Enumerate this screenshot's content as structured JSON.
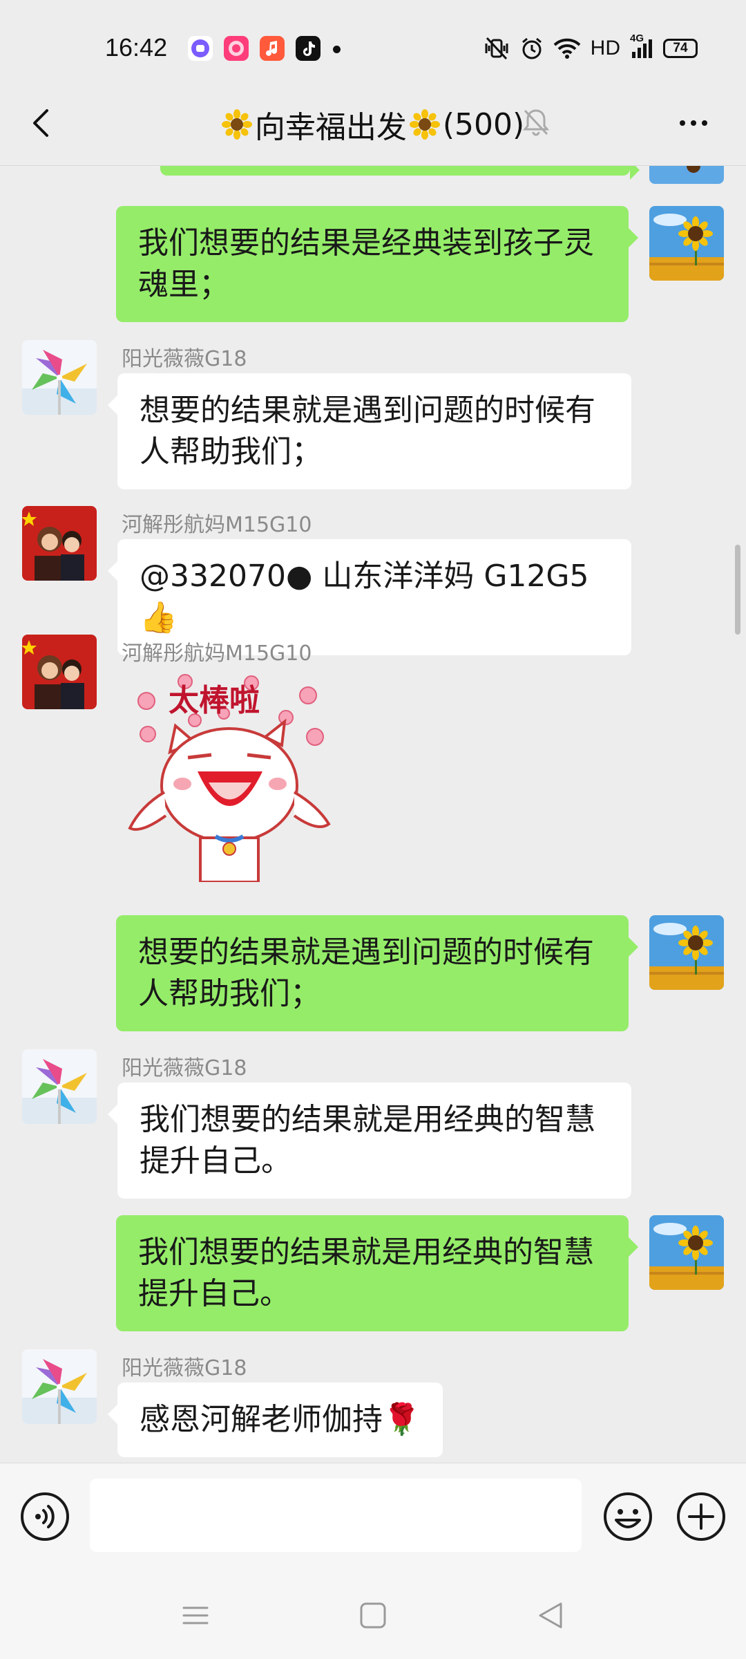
{
  "status_bar": {
    "time": "16:42",
    "network_label": "HD",
    "signal_label": "4G",
    "battery": "74"
  },
  "header": {
    "title": "向幸福出发",
    "member_count": "(500)",
    "title_emoji": "sunflower",
    "icons": [
      "back-arrow-icon",
      "mute-bell-icon",
      "more-dots-icon"
    ]
  },
  "messages": [
    {
      "side": "out",
      "text": ""
    },
    {
      "side": "out",
      "text": "我们想要的结果是经典装到孩子灵魂里；",
      "lines": [
        "我们想要的结果是经典装到孩子灵",
        "魂里；"
      ]
    },
    {
      "side": "in",
      "sender": "阳光薇薇G18",
      "lines": [
        "想要的结果就是遇到问题的时候有",
        "人帮助我们；"
      ]
    },
    {
      "side": "in",
      "sender": "河解彤航妈M15G10",
      "lines": [
        "@332070● 山东洋洋妈 G12G5 👍"
      ]
    },
    {
      "side": "in",
      "sender": "河解彤航妈M15G10",
      "sticker": "太棒啦"
    },
    {
      "side": "out",
      "lines": [
        "想要的结果就是遇到问题的时候有",
        "人帮助我们；"
      ]
    },
    {
      "side": "in",
      "sender": "阳光薇薇G18",
      "lines": [
        "我们想要的结果就是用经典的智慧",
        "提升自己。"
      ]
    },
    {
      "side": "out",
      "lines": [
        "我们想要的结果就是用经典的智慧",
        "提升自己。"
      ]
    },
    {
      "side": "in",
      "sender": "阳光薇薇G18",
      "lines": [
        "感恩河解老师伽持🌹"
      ]
    }
  ],
  "colors": {
    "background": "#ededed",
    "outgoing_bubble": "#95ec69",
    "incoming_bubble": "#ffffff",
    "sender_name": "#8a8a8a"
  },
  "input_bar": {
    "icons": [
      "voice-icon",
      "emoji-icon",
      "plus-icon"
    ]
  },
  "nav_bar": {
    "icons": [
      "menu-icon",
      "home-icon",
      "back-icon"
    ]
  }
}
